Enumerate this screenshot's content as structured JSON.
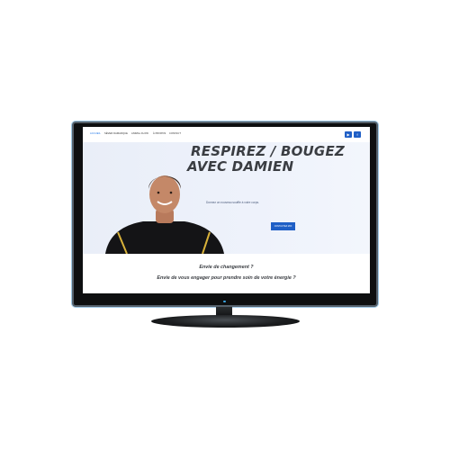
{
  "nav": {
    "items": [
      {
        "label": "Accueil",
        "active": true
      },
      {
        "label": "Séver Damarque",
        "active": false
      },
      {
        "label": "Animal Flow",
        "active": false
      },
      {
        "label": "À propos",
        "active": false
      },
      {
        "label": "Contact",
        "active": false
      }
    ],
    "social": [
      {
        "icon": "youtube-icon",
        "glyph": "▶"
      },
      {
        "icon": "facebook-icon",
        "glyph": "f"
      }
    ]
  },
  "hero": {
    "title_line1": "RESPIREZ / BOUGEZ",
    "title_line2": "AVEC DAMIEN",
    "subtitle": "Donnez un nouveau souffle à votre corps.",
    "button_label": "Contactez moi"
  },
  "section": {
    "question1": "Envie de changement ?",
    "question2": "Envie de vous engager pour prendre soin de votre énergie ?"
  },
  "colors": {
    "accent": "#1f5fc6",
    "bezel": "#0e0f10",
    "hero_bg": "#eef2fb"
  }
}
